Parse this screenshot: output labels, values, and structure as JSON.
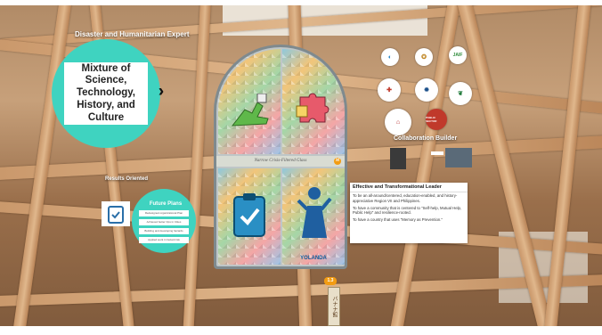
{
  "headlines": {
    "disaster_expert": "Disaster and Humanitarian Expert",
    "results_oriented": "Results Oriented",
    "collaboration_builder": "Collaboration Builder"
  },
  "main_circle": {
    "text": "Mixture of Science, Technology, History, and Culture"
  },
  "chevrons_icon": "triple-chevron-right-icon",
  "stained_window": {
    "caption": "Narrow Crisis-Filtered Glass",
    "badge": "M",
    "panes": [
      {
        "name": "pane-top-left",
        "icon": "robot-hand-icon",
        "label": ""
      },
      {
        "name": "pane-top-right",
        "icon": "puzzle-piece-icon",
        "label": ""
      },
      {
        "name": "pane-bottom-left",
        "icon": "clipboard-check-icon",
        "label": ""
      },
      {
        "name": "pane-bottom-right",
        "icon": "typhoon-figure-icon",
        "label": "YOLANDA"
      }
    ]
  },
  "future_plans": {
    "title": "Future Plans",
    "items": [
      "Redesigned organizational Plan",
      "Achieved better Ops in Cities",
      "Building and developing hazards",
      "Applied work in hazard risk"
    ]
  },
  "leadership_card": {
    "title": "Effective and Transformational Leader",
    "lines": [
      "To be an all-around/centered, education-enabled, and history-appreciative Region VII and Philippines.",
      "To have a community that is centered to \"Self-help, Mutual Help, Public Help\" and resilience-rooted.",
      "To have a country that uses \"Memory as Prevention.\""
    ]
  },
  "logos": [
    {
      "name": "logo-agency-blue",
      "icon": "droplet-seal-icon"
    },
    {
      "name": "logo-seal-round",
      "icon": "seal-icon"
    },
    {
      "name": "logo-jica",
      "icon": "jica-icon",
      "text": "JAIF"
    },
    {
      "name": "logo-red-cross",
      "icon": "hands-seal-icon"
    },
    {
      "name": "logo-ocd",
      "icon": "ocd-seal-icon"
    },
    {
      "name": "logo-denr",
      "icon": "leaf-seal-icon"
    },
    {
      "name": "logo-dpwh",
      "icon": "building-seal-icon"
    },
    {
      "name": "logo-public-sector",
      "icon": "red-badge-icon",
      "text": "PUBLIC SECTOR"
    }
  ],
  "sign": {
    "text": "バナナ館",
    "tag": "1.3"
  },
  "colors": {
    "teal": "#3fd3c0",
    "wood": "#c9976a",
    "accent": "#f39c12"
  }
}
